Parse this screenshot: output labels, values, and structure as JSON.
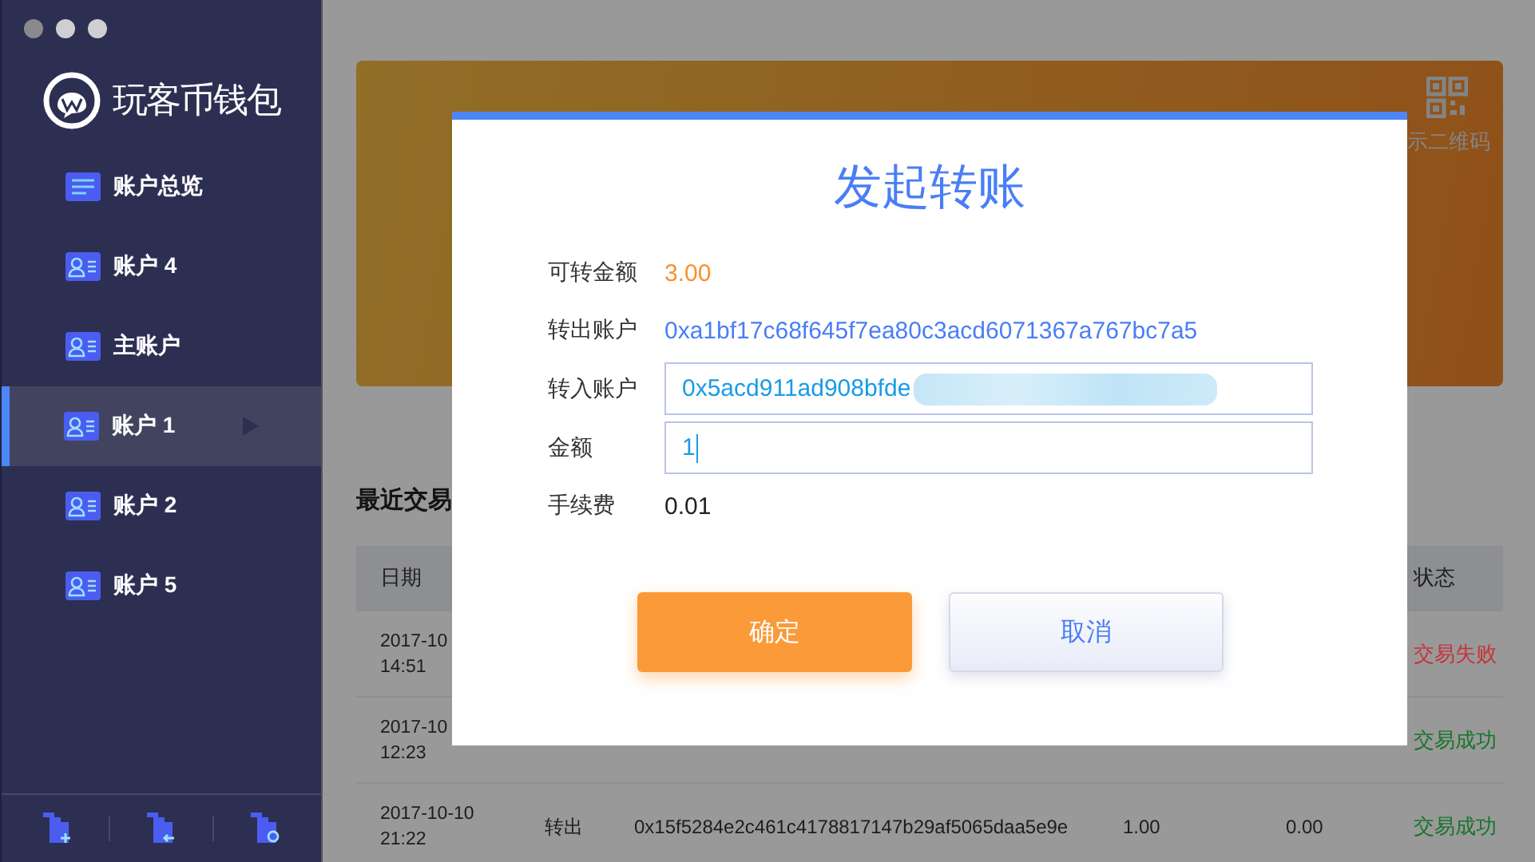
{
  "sidebar": {
    "logo_text": "玩客币钱包",
    "items": [
      {
        "label": "账户总览",
        "kind": "overview",
        "selected": false
      },
      {
        "label": "账户 4",
        "kind": "account",
        "selected": false
      },
      {
        "label": "主账户",
        "kind": "account",
        "selected": false
      },
      {
        "label": "账户 1",
        "kind": "account",
        "selected": true
      },
      {
        "label": "账户 2",
        "kind": "account",
        "selected": false
      },
      {
        "label": "账户 5",
        "kind": "account",
        "selected": false
      }
    ],
    "footer_buttons": [
      {
        "kind": "add"
      },
      {
        "kind": "import"
      },
      {
        "kind": "restore"
      }
    ]
  },
  "banner": {
    "qr_label": "示二维码"
  },
  "recent": {
    "title": "最近交易",
    "columns": [
      {
        "label": "日期",
        "kind": "date"
      },
      {
        "label": "状态",
        "kind": "status"
      }
    ],
    "rows": [
      {
        "cells": [
          {
            "text": "2017-10",
            "sub": "14:51",
            "kind": "date"
          },
          {
            "text": "交易失败",
            "kind": "status",
            "color": "#c8323a"
          }
        ]
      },
      {
        "cells": [
          {
            "text": "2017-10",
            "sub": "12:23",
            "kind": "date"
          },
          {
            "text": "交易成功",
            "kind": "status",
            "color": "#16752a"
          }
        ]
      },
      {
        "cells": [
          {
            "text": "2017-10-10",
            "sub": "21:22",
            "kind": "date"
          },
          {
            "text": "转出",
            "kind": "type"
          },
          {
            "text": "0x15f5284e2c461c4178817147b29af5065daa5e9e",
            "kind": "hash"
          },
          {
            "text": "1.00",
            "kind": "amount"
          },
          {
            "text": "0.00",
            "kind": "fee"
          },
          {
            "text": "交易成功",
            "kind": "status",
            "color": "#16752a"
          }
        ]
      }
    ]
  },
  "dialog": {
    "title": "发起转账",
    "fields": [
      {
        "label": "可转金额",
        "kind": "amount",
        "value": "3.00"
      },
      {
        "label": "转出账户",
        "kind": "address",
        "value": "0xa1bf17c68f645f7ea80c3acd6071367a767bc7a5"
      },
      {
        "label": "转入账户",
        "kind": "input",
        "value": "0x5acd911ad908bfde",
        "redacted": true,
        "focused": false
      },
      {
        "label": "金额",
        "kind": "input",
        "value": "1",
        "redacted": false,
        "focused": true
      },
      {
        "label": "手续费",
        "kind": "text",
        "value": "0.01"
      }
    ],
    "buttons": [
      {
        "label": "确定",
        "kind": "primary"
      },
      {
        "label": "取消",
        "kind": "secondary"
      }
    ]
  }
}
